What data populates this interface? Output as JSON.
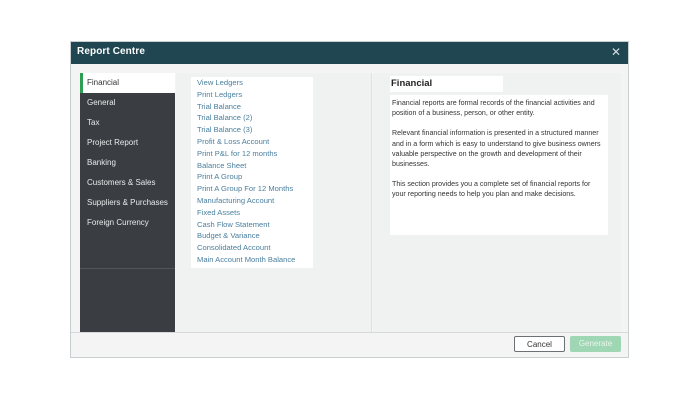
{
  "window": {
    "title": "Report Centre",
    "close_glyph": "✕"
  },
  "icons": {
    "close": "close-icon"
  },
  "colors": {
    "titlebar": "#1f4651",
    "nav_background": "#3a3e42",
    "active_accent": "#2e9e54",
    "link": "#4a7f9e",
    "generate_disabled": "#9fd6b3"
  },
  "sidebar": {
    "items": [
      {
        "label": "Financial",
        "active": true
      },
      {
        "label": "General",
        "active": false
      },
      {
        "label": "Tax",
        "active": false
      },
      {
        "label": "Project Report",
        "active": false
      },
      {
        "label": "Banking",
        "active": false
      },
      {
        "label": "Customers & Sales",
        "active": false
      },
      {
        "label": "Suppliers & Purchases",
        "active": false
      },
      {
        "label": "Foreign Currency",
        "active": false
      }
    ]
  },
  "reports": {
    "items": [
      "View Ledgers",
      "Print Ledgers",
      "Trial Balance",
      "Trial Balance (2)",
      "Trial Balance (3)",
      "Profit & Loss Account",
      "Print P&L for 12 months",
      "Balance Sheet",
      "Print A Group",
      "Print A Group For 12 Months",
      "Manufacturing Account",
      "Fixed Assets",
      "Cash Flow Statement",
      "Budget & Variance",
      "Consolidated Account",
      "Main Account Month Balance"
    ]
  },
  "info": {
    "title": "Financial",
    "paragraphs": [
      "Financial reports are formal records of the financial activities and position of a business, person, or other entity.",
      "Relevant financial information is presented in a structured manner and in a form which is easy to understand to give business owners valuable perspective on the growth and development of their businesses.",
      "This section provides you a complete set of financial reports for your reporting needs to help you plan and make decisions."
    ]
  },
  "footer": {
    "cancel_label": "Cancel",
    "generate_label": "Generate"
  }
}
